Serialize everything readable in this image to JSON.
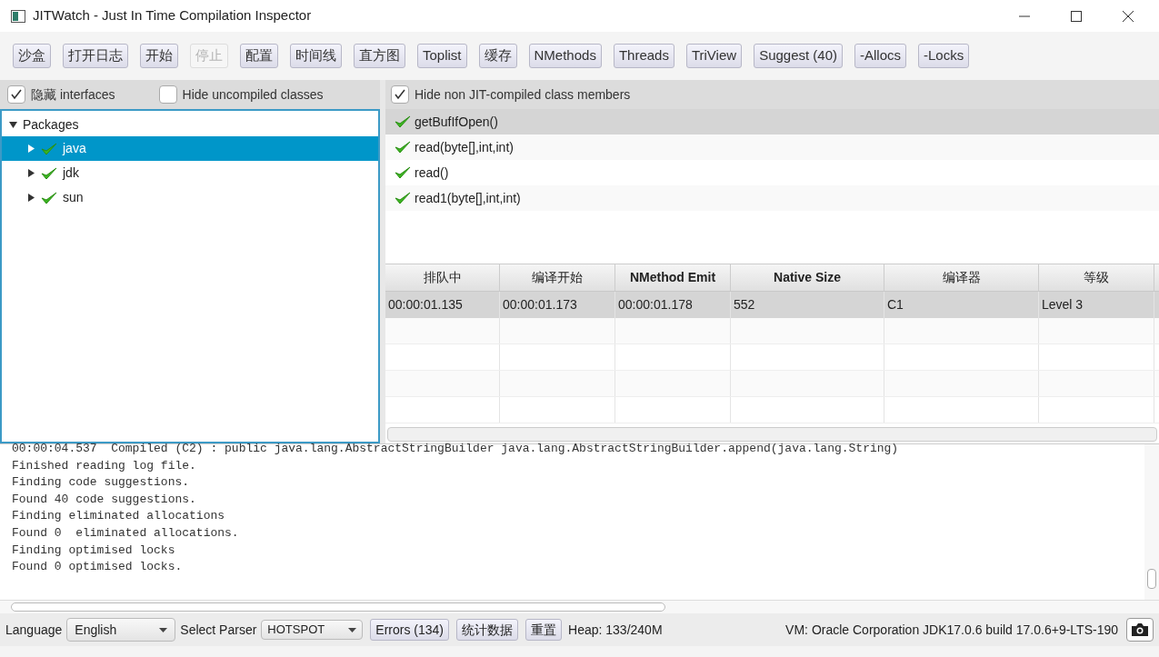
{
  "window": {
    "title": "JITWatch - Just In Time Compilation Inspector"
  },
  "toolbar": [
    {
      "label": "沙盒",
      "disabled": false
    },
    {
      "label": "打开日志",
      "disabled": false
    },
    {
      "label": "开始",
      "disabled": false
    },
    {
      "label": "停止",
      "disabled": true
    },
    {
      "label": "配置",
      "disabled": false
    },
    {
      "label": "时间线",
      "disabled": false
    },
    {
      "label": "直方图",
      "disabled": false
    },
    {
      "label": "Toplist",
      "disabled": false
    },
    {
      "label": "缓存",
      "disabled": false
    },
    {
      "label": "NMethods",
      "disabled": false
    },
    {
      "label": "Threads",
      "disabled": false
    },
    {
      "label": "TriView",
      "disabled": false
    },
    {
      "label": "Suggest (40)",
      "disabled": false
    },
    {
      "label": "-Allocs",
      "disabled": false
    },
    {
      "label": "-Locks",
      "disabled": false
    }
  ],
  "left_filters": [
    {
      "label": "隐藏 interfaces",
      "checked": true
    },
    {
      "label": "Hide uncompiled classes",
      "checked": false
    }
  ],
  "tree": {
    "label": "Packages",
    "expanded": true,
    "children": [
      {
        "label": "java",
        "expanded": false,
        "selected": true,
        "compiled": true
      },
      {
        "label": "jdk",
        "expanded": false,
        "selected": false,
        "compiled": true
      },
      {
        "label": "sun",
        "expanded": false,
        "selected": false,
        "compiled": true
      }
    ]
  },
  "member_filter": {
    "label": "Hide non JIT-compiled class members",
    "checked": true
  },
  "members": [
    {
      "label": "getBufIfOpen()",
      "selected": true,
      "compiled": true
    },
    {
      "label": "read(byte[],int,int)",
      "selected": false,
      "compiled": true
    },
    {
      "label": "read()",
      "selected": false,
      "compiled": true
    },
    {
      "label": "read1(byte[],int,int)",
      "selected": false,
      "compiled": true
    }
  ],
  "compilations": {
    "columns": [
      {
        "label": "排队中",
        "bold": false
      },
      {
        "label": "编译开始",
        "bold": false
      },
      {
        "label": "NMethod Emit",
        "bold": true
      },
      {
        "label": "Native Size",
        "bold": true
      },
      {
        "label": "编译器",
        "bold": false
      },
      {
        "label": "等级",
        "bold": false
      }
    ],
    "rows": [
      {
        "selected": true,
        "cells": [
          "00:00:01.135",
          "00:00:01.173",
          "00:00:01.178",
          "552",
          "C1",
          "Level 3"
        ]
      }
    ]
  },
  "log": [
    "00:00:04.537  Compiled (C2) : public java.lang.AbstractStringBuilder java.lang.AbstractStringBuilder.append(java.lang.String)",
    "Finished reading log file.",
    "Finding code suggestions.",
    "Found 40 code suggestions.",
    "Finding eliminated allocations",
    "Found 0  eliminated allocations.",
    "Finding optimised locks",
    "Found 0 optimised locks."
  ],
  "status_bar": {
    "language_label": "Language",
    "language": "English",
    "parser_label": "Select Parser",
    "parser": "HOTSPOT",
    "buttons": [
      "Errors (134)",
      "统计数据",
      "重置"
    ],
    "heap": "Heap: 133/240M",
    "vm": "VM: Oracle Corporation JDK17.0.6 build 17.0.6+9-LTS-190"
  }
}
